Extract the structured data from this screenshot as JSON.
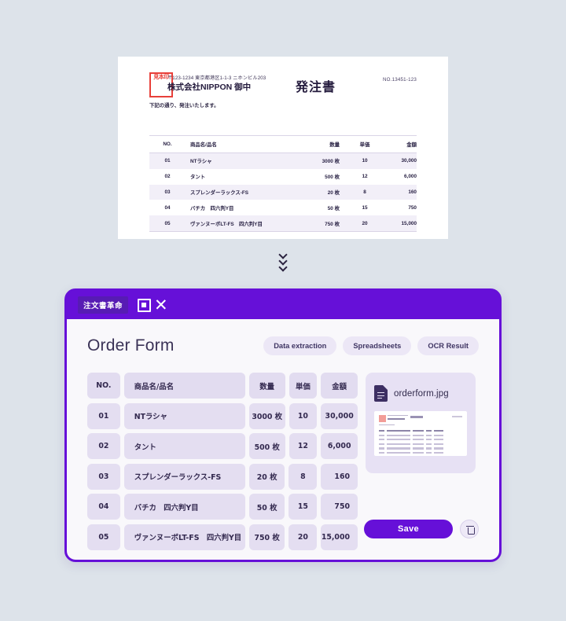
{
  "colors": {
    "brand_purple": "#6610d8",
    "badge_purple": "#571bb4",
    "page_background": "#dde3ea",
    "app_body": "#f9f8fb",
    "cell_lavender": "#e4def1",
    "pill_lavender": "#ece7f6",
    "stamp_red": "#e8403a",
    "text_dark": "#33294f"
  },
  "scanned_document": {
    "postal_address": "〒123-1234 東京都港区1-1-3 ニホンビル203",
    "company_line": "株式会社NIPPON 御中",
    "stamp_text": "見本印",
    "note": "下記の通り、発注いたします。",
    "title": "発注書",
    "document_number": "NO.13451-123",
    "table": {
      "headers": [
        "NO.",
        "商品名/品名",
        "数量",
        "単価",
        "金額"
      ],
      "rows": [
        {
          "no": "01",
          "name": "NTラシャ",
          "qty": "3000 枚",
          "price": "10",
          "amount": "30,000"
        },
        {
          "no": "02",
          "name": "タント",
          "qty": "500 枚",
          "price": "12",
          "amount": "6,000"
        },
        {
          "no": "03",
          "name": "スプレンダーラックス-FS",
          "qty": "20 枚",
          "price": "8",
          "amount": "160"
        },
        {
          "no": "04",
          "name": "バチカ　四六判Y目",
          "qty": "50 枚",
          "price": "15",
          "amount": "750"
        },
        {
          "no": "05",
          "name": "ヴァンヌーボLT-FS　四六判Y目",
          "qty": "750 枚",
          "price": "20",
          "amount": "15,000"
        }
      ]
    }
  },
  "divider": {
    "icon": "chevron-down-icon",
    "count": 3
  },
  "app": {
    "header": {
      "badge_label": "注文書革命",
      "logo_text": "DX"
    },
    "page_title": "Order Form",
    "tabs": [
      {
        "label": "Data extraction"
      },
      {
        "label": "Spreadsheets"
      },
      {
        "label": "OCR Result"
      }
    ],
    "table": {
      "headers": [
        "NO.",
        "商品名/品名",
        "数量",
        "単価",
        "金額"
      ],
      "rows": [
        {
          "no": "01",
          "name": "NTラシャ",
          "qty": "3000 枚",
          "price": "10",
          "amount": "30,000",
          "amount_align": "center"
        },
        {
          "no": "02",
          "name": "タント",
          "qty": "500  枚",
          "price": "12",
          "amount": "6,000",
          "amount_align": "center"
        },
        {
          "no": "03",
          "name": "スプレンダーラックス-FS",
          "qty": "20 枚",
          "price": "8",
          "amount": "160",
          "amount_align": "right"
        },
        {
          "no": "04",
          "name": "バチカ　四六判Y目",
          "qty": "50 枚",
          "price": "15",
          "amount": "750",
          "amount_align": "right"
        },
        {
          "no": "05",
          "name": "ヴァンヌーボLT-FS　四六判Y目",
          "qty": "750 枚",
          "price": "20",
          "amount": "15,000",
          "amount_align": "right"
        }
      ]
    },
    "preview": {
      "file_icon": "document-file-icon",
      "file_name": "orderform.jpg"
    },
    "actions": {
      "save_label": "Save",
      "delete_icon": "trash-icon"
    }
  }
}
